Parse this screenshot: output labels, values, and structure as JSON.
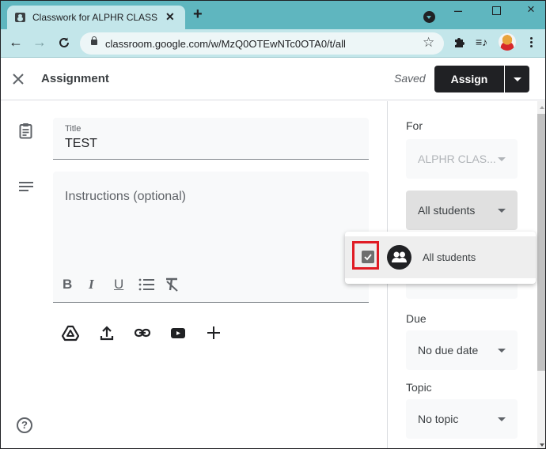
{
  "browser": {
    "tab": {
      "title": "Classwork for ALPHR CLASS SAMPLE",
      "favicon": "classroom-icon"
    },
    "url": "classroom.google.com/w/MzQ0OTEwNTc0OTA0/t/all",
    "window_controls": {
      "minimize": "–",
      "close": "×"
    },
    "nav": {
      "back": "←",
      "forward": "→",
      "reload": "C"
    },
    "star": "☆",
    "media_icon": "≡♪"
  },
  "header": {
    "close": "×",
    "title": "Assignment",
    "status": "Saved",
    "assign_label": "Assign"
  },
  "form": {
    "title_label": "Title",
    "title_value": "TEST",
    "instructions_placeholder": "Instructions (optional)",
    "format_buttons": {
      "bold": "B",
      "italic": "I",
      "underline": "U"
    },
    "attach_icons": [
      "google-drive-icon",
      "upload-icon",
      "link-icon",
      "youtube-icon",
      "create-icon"
    ],
    "help": "?"
  },
  "sidebar": {
    "for_label": "For",
    "class_select": "ALPHR CLAS...",
    "students_select": "All students",
    "due_label": "Due",
    "due_select": "No due date",
    "topic_label": "Topic",
    "topic_select": "No topic"
  },
  "popup": {
    "item_label": "All students",
    "checked": true
  },
  "colors": {
    "tabstrip": "#5fb6bf",
    "toolbar": "#c3e6ea",
    "primary_button": "#202124",
    "highlight": "#e01b24"
  }
}
